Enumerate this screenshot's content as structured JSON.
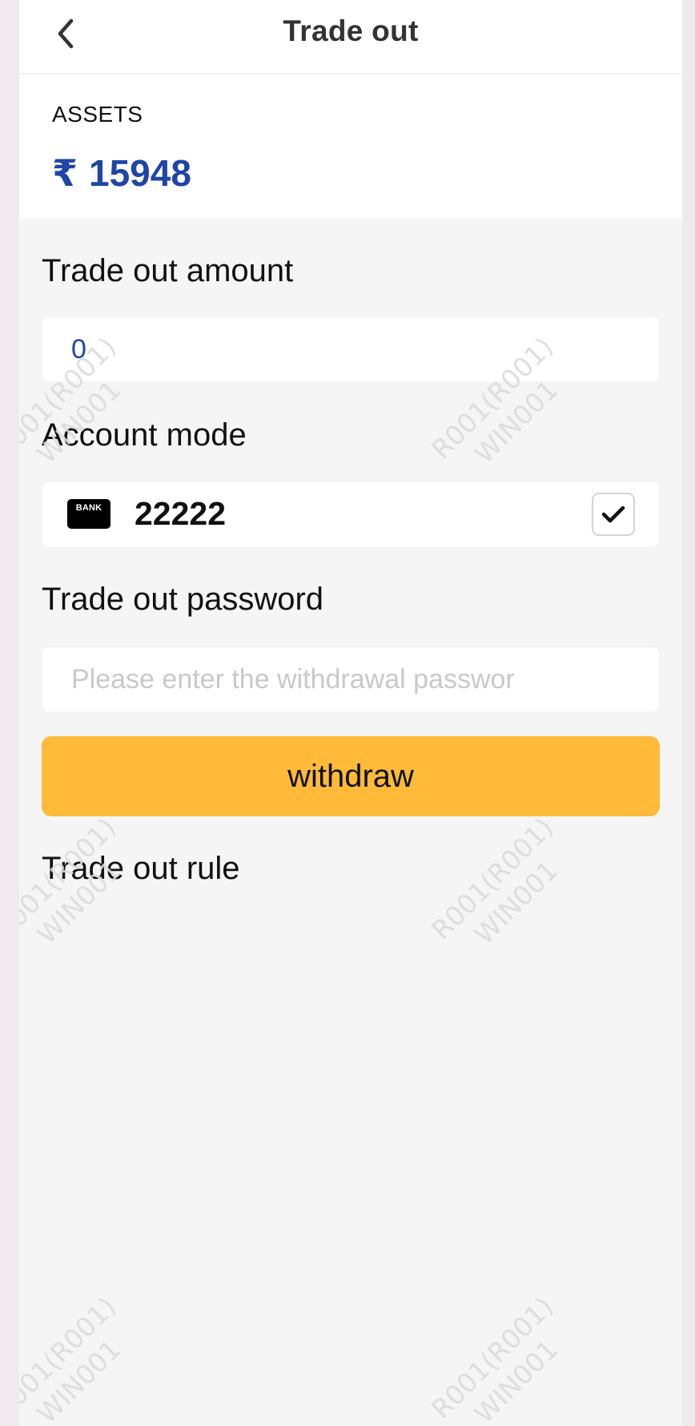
{
  "header": {
    "title": "Trade out"
  },
  "assets": {
    "label": "ASSETS",
    "currency": "₹",
    "value": "15948"
  },
  "form": {
    "amount_label": "Trade out amount",
    "amount_value": "0",
    "account_mode_label": "Account mode",
    "account": {
      "badge": "BANK",
      "number": "22222",
      "checked": true
    },
    "password_label": "Trade out password",
    "password_placeholder": "Please enter the withdrawal passwor",
    "withdraw_label": "withdraw",
    "rule_label": "Trade out rule"
  },
  "watermark": {
    "line1": "R001(R001)",
    "line2": "WIN001"
  },
  "colors": {
    "accent": "#ffba39",
    "assets_blue": "#1f45a6",
    "background": "#f5f5f5"
  },
  "icons": {
    "back": "chevron-left-icon",
    "bank": "bank-card-icon",
    "check": "check-icon"
  }
}
